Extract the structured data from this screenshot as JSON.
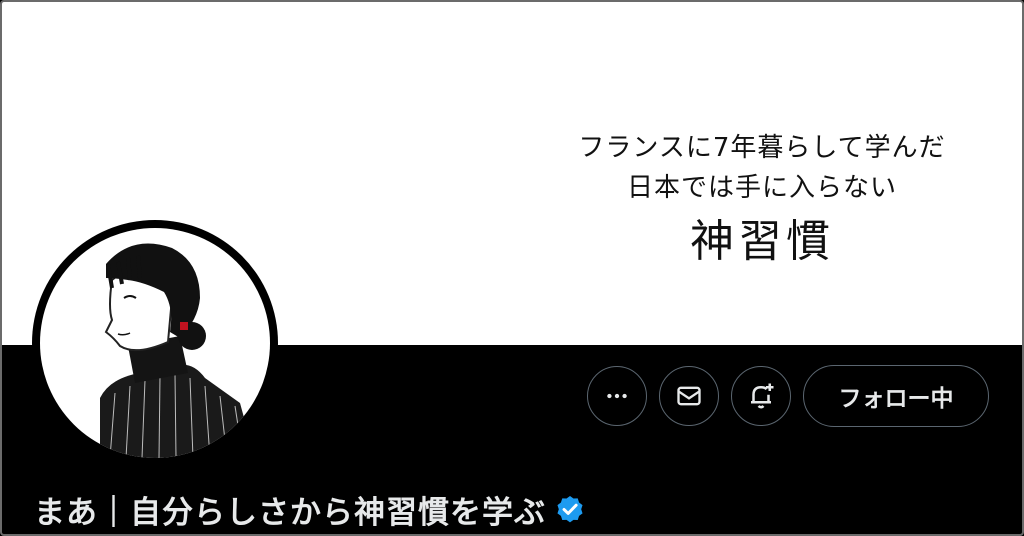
{
  "banner": {
    "line1": "フランスに7年暮らして学んだ",
    "line2": "日本では手に入らない",
    "title": "神習慣"
  },
  "actions": {
    "more_icon": "more-horizontal-icon",
    "message_icon": "envelope-icon",
    "notify_icon": "bell-plus-icon",
    "follow_label": "フォロー中"
  },
  "profile": {
    "display_name": "まあ｜自分らしさから神習慣を学ぶ",
    "verified_icon": "verified-badge-icon"
  },
  "colors": {
    "background": "#000000",
    "banner": "#ffffff",
    "text": "#e7e9ea",
    "border": "#5b6670",
    "verified": "#1d9bf0"
  }
}
